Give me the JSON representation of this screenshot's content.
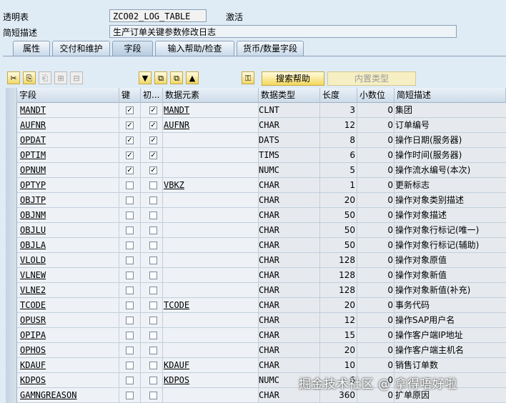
{
  "header": {
    "table_label": "透明表",
    "table_name": "ZCO02_LOG_TABLE",
    "status": "激活",
    "desc_label": "简短描述",
    "description": "生产订单关键参数修改日志"
  },
  "tabs": [
    "属性",
    "交付和维护",
    "字段",
    "输入帮助/检查",
    "货币/数量字段"
  ],
  "active_tab": "字段",
  "toolbar": {
    "icons": [
      "cut-icon",
      "copy-icon",
      "paste-icon",
      "insert-row-icon",
      "delete-row-icon",
      "move-down-icon",
      "first-page-icon",
      "last-page-icon",
      "move-up-icon",
      "where-used-icon"
    ],
    "search_help_label": "搜索帮助",
    "builtin_type_label": "内置类型"
  },
  "table": {
    "headers": [
      "字段",
      "键",
      "初...",
      "数据元素",
      "数据类型",
      "长度",
      "小数位",
      "简短描述"
    ],
    "rows": [
      {
        "field": "MANDT",
        "key": true,
        "init": true,
        "element": "MANDT",
        "type": "CLNT",
        "length": "3",
        "dec": "0",
        "desc": "集团"
      },
      {
        "field": "AUFNR",
        "key": true,
        "init": true,
        "element": "AUFNR",
        "type": "CHAR",
        "length": "12",
        "dec": "0",
        "desc": "订单编号"
      },
      {
        "field": "OPDAT",
        "key": true,
        "init": true,
        "element": "",
        "type": "DATS",
        "length": "8",
        "dec": "0",
        "desc": "操作日期(服务器)"
      },
      {
        "field": "OPTIM",
        "key": true,
        "init": true,
        "element": "",
        "type": "TIMS",
        "length": "6",
        "dec": "0",
        "desc": "操作时间(服务器)"
      },
      {
        "field": "OPNUM",
        "key": true,
        "init": true,
        "element": "",
        "type": "NUMC",
        "length": "5",
        "dec": "0",
        "desc": "操作流水编号(本次)"
      },
      {
        "field": "OPTYP",
        "key": false,
        "init": false,
        "element": "VBKZ",
        "type": "CHAR",
        "length": "1",
        "dec": "0",
        "desc": "更新标志"
      },
      {
        "field": "OBJTP",
        "key": false,
        "init": false,
        "element": "",
        "type": "CHAR",
        "length": "20",
        "dec": "0",
        "desc": "操作对象类别描述"
      },
      {
        "field": "OBJNM",
        "key": false,
        "init": false,
        "element": "",
        "type": "CHAR",
        "length": "50",
        "dec": "0",
        "desc": "操作对象描述"
      },
      {
        "field": "OBJLU",
        "key": false,
        "init": false,
        "element": "",
        "type": "CHAR",
        "length": "50",
        "dec": "0",
        "desc": "操作对象行标记(唯一)"
      },
      {
        "field": "OBJLA",
        "key": false,
        "init": false,
        "element": "",
        "type": "CHAR",
        "length": "50",
        "dec": "0",
        "desc": "操作对象行标记(辅助)"
      },
      {
        "field": "VLOLD",
        "key": false,
        "init": false,
        "element": "",
        "type": "CHAR",
        "length": "128",
        "dec": "0",
        "desc": "操作对象原值"
      },
      {
        "field": "VLNEW",
        "key": false,
        "init": false,
        "element": "",
        "type": "CHAR",
        "length": "128",
        "dec": "0",
        "desc": "操作对象新值"
      },
      {
        "field": "VLNE2",
        "key": false,
        "init": false,
        "element": "",
        "type": "CHAR",
        "length": "128",
        "dec": "0",
        "desc": "操作对象新值(补充)"
      },
      {
        "field": "TCODE",
        "key": false,
        "init": false,
        "element": "TCODE",
        "type": "CHAR",
        "length": "20",
        "dec": "0",
        "desc": "事务代码"
      },
      {
        "field": "OPUSR",
        "key": false,
        "init": false,
        "element": "",
        "type": "CHAR",
        "length": "12",
        "dec": "0",
        "desc": "操作SAP用户名"
      },
      {
        "field": "OPIPA",
        "key": false,
        "init": false,
        "element": "",
        "type": "CHAR",
        "length": "15",
        "dec": "0",
        "desc": "操作客户端IP地址"
      },
      {
        "field": "OPHOS",
        "key": false,
        "init": false,
        "element": "",
        "type": "CHAR",
        "length": "20",
        "dec": "0",
        "desc": "操作客户端主机名"
      },
      {
        "field": "KDAUF",
        "key": false,
        "init": false,
        "element": "KDAUF",
        "type": "CHAR",
        "length": "10",
        "dec": "0",
        "desc": "销售订单数"
      },
      {
        "field": "KDPOS",
        "key": false,
        "init": false,
        "element": "KDPOS",
        "type": "NUMC",
        "length": "6",
        "dec": "0",
        "desc": ""
      },
      {
        "field": "GAMNGREASON",
        "key": false,
        "init": false,
        "element": "",
        "type": "CHAR",
        "length": "360",
        "dec": "0",
        "desc": "扩单原因"
      }
    ]
  },
  "watermark": "掘金技术社区 @ 拿得唔好啦"
}
